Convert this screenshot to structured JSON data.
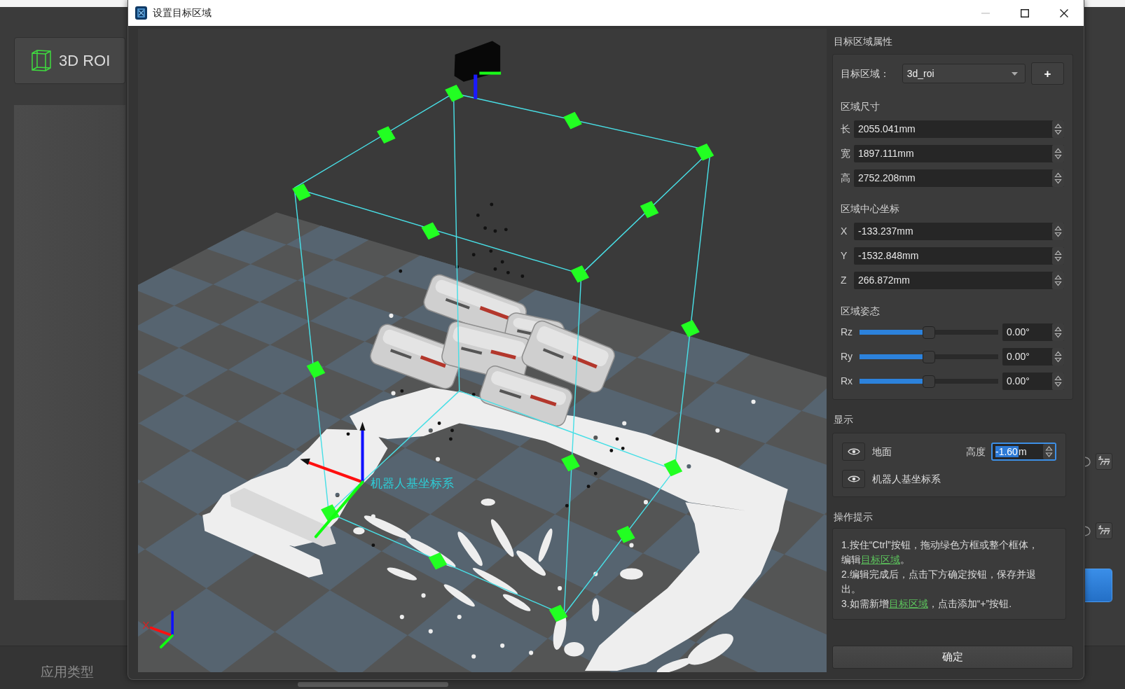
{
  "app": {
    "roi_button": {
      "label": "3D ROI"
    },
    "bottom_tab": {
      "label": "应用类型"
    }
  },
  "dialog": {
    "title": "设置目标区域",
    "window_controls": [
      {
        "kind": "minimize",
        "disabled": true
      },
      {
        "kind": "maximize",
        "disabled": false
      },
      {
        "kind": "close",
        "disabled": false
      }
    ]
  },
  "viewport": {
    "axes_label": "机器人基坐标系",
    "triad_label": "X"
  },
  "properties": {
    "title": "目标区域属性",
    "region": {
      "label": "目标区域：",
      "value": "3d_roi",
      "add_label": "+"
    },
    "sections": [
      {
        "kind": "fields",
        "title": "区域尺寸",
        "rows": [
          {
            "label": "长",
            "value": "2055.041mm"
          },
          {
            "label": "宽",
            "value": "1897.111mm"
          },
          {
            "label": "高",
            "value": "2752.208mm"
          }
        ]
      },
      {
        "kind": "fields",
        "title": "区域中心坐标",
        "rows": [
          {
            "label": "X",
            "value": "-133.237mm"
          },
          {
            "label": "Y",
            "value": "-1532.848mm"
          },
          {
            "label": "Z",
            "value": "266.872mm"
          }
        ]
      },
      {
        "kind": "sliders",
        "title": "区域姿态",
        "rows": [
          {
            "label": "Rz",
            "level": 0.5,
            "value": "0.00°"
          },
          {
            "label": "Ry",
            "level": 0.5,
            "value": "0.00°"
          },
          {
            "label": "Rx",
            "level": 0.5,
            "value": "0.00°"
          }
        ]
      }
    ]
  },
  "display": {
    "title": "显示",
    "items": [
      {
        "kind": "height",
        "label": "地面",
        "visible": true,
        "height_label": "高度",
        "height_value": "-1.60",
        "height_unit": "m",
        "focused": true,
        "value_selected": true
      },
      {
        "kind": "plain",
        "label": "机器人基坐标系",
        "visible": true
      }
    ]
  },
  "tips": {
    "title": "操作提示",
    "lines": [
      [
        {
          "text": "1.按住“Ctrl”按钮，拖动绿色方框或整个框体，编辑"
        },
        {
          "link": "目标区域"
        },
        {
          "text": "。"
        }
      ],
      [
        {
          "text": "2.编辑完成后，点击下方确定按钮，保存并退出。"
        }
      ],
      [
        {
          "text": "3.如需新增"
        },
        {
          "link": "目标区域"
        },
        {
          "text": "，点击添加“+”按钮."
        }
      ]
    ]
  },
  "confirm_button": {
    "label": "确定"
  }
}
